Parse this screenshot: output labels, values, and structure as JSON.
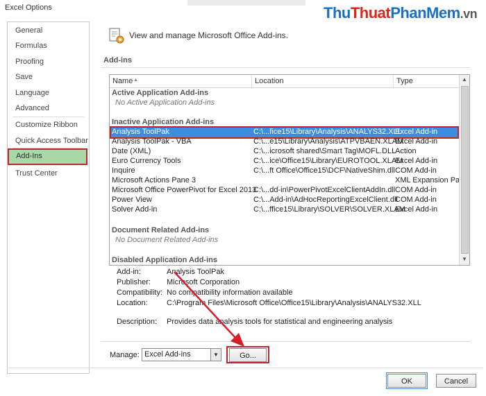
{
  "window": {
    "title": "Excel Options"
  },
  "watermark": {
    "part1": "Thu",
    "part2": "Thuat",
    "part3": "PhanMem",
    "part4": ".vn"
  },
  "sidebar": {
    "items": [
      {
        "label": "General",
        "name": "sidebar-item-general"
      },
      {
        "label": "Formulas",
        "name": "sidebar-item-formulas"
      },
      {
        "label": "Proofing",
        "name": "sidebar-item-proofing"
      },
      {
        "label": "Save",
        "name": "sidebar-item-save"
      },
      {
        "label": "Language",
        "name": "sidebar-item-language"
      },
      {
        "label": "Advanced",
        "name": "sidebar-item-advanced"
      },
      {
        "label": "Customize Ribbon",
        "name": "sidebar-item-customize-ribbon"
      },
      {
        "label": "Quick Access Toolbar",
        "name": "sidebar-item-quick-access-toolbar"
      },
      {
        "label": "Add-Ins",
        "name": "sidebar-item-add-ins",
        "selected": true
      },
      {
        "label": "Trust Center",
        "name": "sidebar-item-trust-center"
      }
    ]
  },
  "header": {
    "text": "View and manage Microsoft Office Add-ins."
  },
  "section": {
    "label": "Add-ins"
  },
  "table": {
    "columns": {
      "name": "Name",
      "location": "Location",
      "type": "Type"
    },
    "sort_indicator": "▲",
    "groups": {
      "active": {
        "title": "Active Application Add-ins",
        "empty": "No Active Application Add-ins"
      },
      "inactive": {
        "title": "Inactive Application Add-ins",
        "rows": [
          {
            "name": "Analysis ToolPak",
            "location": "C:\\...fice15\\Library\\Analysis\\ANALYS32.XLL",
            "type": "Excel Add-in",
            "selected": true
          },
          {
            "name": "Analysis ToolPak - VBA",
            "location": "C:\\...e15\\Library\\Analysis\\ATPVBAEN.XLAM",
            "type": "Excel Add-in"
          },
          {
            "name": "Date (XML)",
            "location": "C:\\...icrosoft shared\\Smart Tag\\MOFL.DLL",
            "type": "Action"
          },
          {
            "name": "Euro Currency Tools",
            "location": "C:\\...ice\\Office15\\Library\\EUROTOOL.XLAM",
            "type": "Excel Add-in"
          },
          {
            "name": "Inquire",
            "location": "C:\\...ft Office\\Office15\\DCF\\NativeShim.dll",
            "type": "COM Add-in"
          },
          {
            "name": "Microsoft Actions Pane 3",
            "location": "",
            "type": "XML Expansion Pack"
          },
          {
            "name": "Microsoft Office PowerPivot for Excel 2013",
            "location": "C:\\...dd-in\\PowerPivotExcelClientAddIn.dll",
            "type": "COM Add-in"
          },
          {
            "name": "Power View",
            "location": "C:\\...Add-in\\AdHocReportingExcelClient.dll",
            "type": "COM Add-in"
          },
          {
            "name": "Solver Add-in",
            "location": "C:\\...ffice15\\Library\\SOLVER\\SOLVER.XLAM",
            "type": "Excel Add-in"
          }
        ]
      },
      "document": {
        "title": "Document Related Add-ins",
        "empty": "No Document Related Add-ins"
      },
      "disabled": {
        "title": "Disabled Application Add-ins"
      }
    }
  },
  "details": {
    "addin_label": "Add-in:",
    "addin_value": "Analysis ToolPak",
    "publisher_label": "Publisher:",
    "publisher_value": "Microsoft Corporation",
    "compat_label": "Compatibility:",
    "compat_value": "No compatibility information available",
    "location_label": "Location:",
    "location_value": "C:\\Program Files\\Microsoft Office\\Office15\\Library\\Analysis\\ANALYS32.XLL",
    "desc_label": "Description:",
    "desc_value": "Provides data analysis tools for statistical and engineering analysis"
  },
  "manage": {
    "label": "Manage:",
    "selected": "Excel Add-ins",
    "go_label": "Go..."
  },
  "footer": {
    "ok_label": "OK",
    "cancel_label": "Cancel"
  },
  "colors": {
    "selection": "#3a8de0",
    "highlight_border": "#c0252c",
    "nav_selected_bg": "#a8d8a8"
  },
  "icons": {
    "header": "addins-gear-page-icon",
    "dropdown": "chevron-down-icon",
    "scroll_up": "scroll-up-icon",
    "scroll_down": "scroll-down-icon"
  }
}
